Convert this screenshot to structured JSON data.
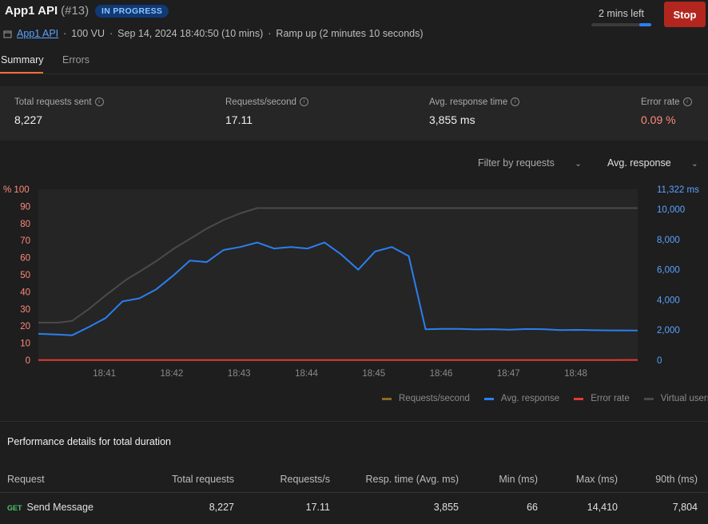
{
  "header": {
    "title": "App1 API",
    "run_number": "(#13)",
    "status": "IN PROGRESS",
    "time_left": "2 mins left",
    "time_left_progress": 0.2,
    "stop_label": "Stop"
  },
  "meta": {
    "collection": "App1 API",
    "sep1": "·",
    "vus": "100 VU",
    "sep2": "·",
    "start": "Sep 14, 2024 18:40:50 (10 mins)",
    "sep3": "·",
    "profile": "Ramp up (2 minutes 10 seconds)"
  },
  "tabs": [
    {
      "label": "Summary",
      "active": true
    },
    {
      "label": "Errors",
      "active": false
    }
  ],
  "stats": [
    {
      "label": "Total requests sent",
      "value": "8,227"
    },
    {
      "label": "Requests/second",
      "value": "17.11"
    },
    {
      "label": "Avg. response time",
      "value": "3,855 ms"
    },
    {
      "label": "Error rate",
      "value": "0.09 %"
    }
  ],
  "filters": {
    "requests": "Filter by requests",
    "metric": "Avg. response"
  },
  "colors": {
    "accent": "#ff6c37",
    "avg_response": "#2a7ff0",
    "error_rate": "#e53935",
    "requests_per_second": "#8a6a1f",
    "virtual_users": "#4a4a4a",
    "error_value": "#ff8a7a"
  },
  "chart_data": {
    "type": "line",
    "left_axis": {
      "unit": "%",
      "max_label": "% 100",
      "ticks": [
        0,
        10,
        20,
        30,
        40,
        50,
        60,
        70,
        80,
        90
      ]
    },
    "right_axis": {
      "max_label": "11,322 ms",
      "ticks": [
        "0",
        "2,000",
        "4,000",
        "6,000",
        "8,000",
        "10,000"
      ],
      "tick_values": [
        0,
        2000,
        4000,
        6000,
        8000,
        10000
      ],
      "max": 11322
    },
    "x_ticks": [
      "18:41",
      "18:42",
      "18:43",
      "18:44",
      "18:45",
      "18:46",
      "18:47",
      "18:48"
    ],
    "x_range": [
      0,
      8.9
    ],
    "x_tick_positions": [
      1,
      2,
      3,
      4,
      5,
      6,
      7,
      8
    ],
    "series": [
      {
        "name": "Virtual users",
        "axis": "left",
        "x": [
          0.0,
          0.3,
          0.5,
          0.75,
          1.0,
          1.3,
          1.55,
          1.75,
          2.0,
          2.25,
          2.5,
          2.75,
          3.0,
          3.25,
          3.5,
          3.75,
          4.0,
          5.0,
          6.0,
          7.0,
          8.0,
          8.9
        ],
        "y": [
          22,
          22,
          23,
          30,
          38,
          47,
          53,
          58,
          65,
          71,
          77,
          82,
          86,
          89,
          89,
          89,
          89,
          89,
          89,
          89,
          89,
          89
        ]
      },
      {
        "name": "Avg. response",
        "axis": "right",
        "x": [
          0.0,
          0.3,
          0.5,
          0.75,
          1.0,
          1.25,
          1.5,
          1.75,
          2.0,
          2.25,
          2.5,
          2.75,
          3.0,
          3.25,
          3.5,
          3.75,
          4.0,
          4.25,
          4.5,
          4.75,
          5.0,
          5.25,
          5.5,
          5.75,
          6.0,
          6.25,
          6.5,
          6.75,
          7.0,
          7.25,
          7.5,
          7.75,
          8.0,
          8.25,
          8.5,
          8.9
        ],
        "y": [
          1750,
          1700,
          1650,
          2200,
          2800,
          3900,
          4100,
          4700,
          5600,
          6600,
          6500,
          7300,
          7500,
          7800,
          7400,
          7500,
          7400,
          7800,
          7000,
          6000,
          7200,
          7500,
          6900,
          2050,
          2080,
          2080,
          2040,
          2060,
          2020,
          2070,
          2060,
          2000,
          2010,
          1990,
          1980,
          1970
        ]
      },
      {
        "name": "Error rate",
        "axis": "left",
        "x": [
          0,
          1,
          2,
          3,
          4,
          5,
          6,
          7,
          8,
          8.9
        ],
        "y": [
          0.1,
          0.1,
          0.1,
          0.1,
          0.1,
          0.1,
          0.1,
          0.1,
          0.1,
          0.2
        ]
      },
      {
        "name": "Requests/second",
        "axis": "left",
        "x": [],
        "y": []
      }
    ],
    "legend": [
      "Requests/second",
      "Avg. response",
      "Error rate",
      "Virtual users"
    ],
    "legend_position": "bottom-right",
    "grid": false
  },
  "performance": {
    "title": "Performance details for total duration",
    "columns": [
      "Request",
      "Total requests",
      "Requests/s",
      "Resp. time (Avg. ms)",
      "Min (ms)",
      "Max (ms)",
      "90th (ms)"
    ],
    "rows": [
      {
        "method": "GET",
        "name": "Send Message",
        "total": "8,227",
        "rps": "17.11",
        "avg": "3,855",
        "min": "66",
        "max": "14,410",
        "p90": "7,804"
      }
    ]
  }
}
